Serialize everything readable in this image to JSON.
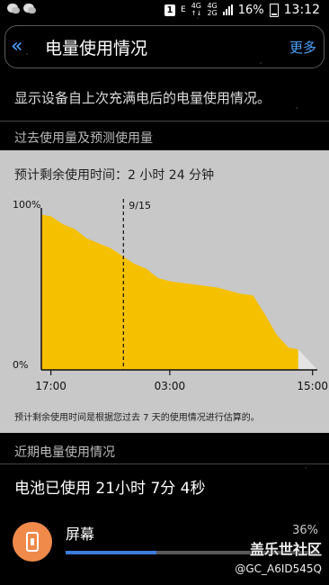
{
  "status_bar": {
    "sim_badge": "1",
    "data_indicator": "E",
    "network_top": "4G",
    "network_bottom": "4G",
    "network_2g": "2G",
    "battery_percent": "16%",
    "time": "13:12"
  },
  "header": {
    "title": "电量使用情况",
    "more_label": "更多"
  },
  "description": "显示设备自上次充满电后的电量使用情况。",
  "section_past": "过去使用量及预测使用量",
  "estimate_text": "预计剩余使用时间：2 小时 24 分钟",
  "chart_data": {
    "type": "area",
    "title": "",
    "ylabel": "",
    "xlabel": "",
    "y_tick_labels": [
      "100%",
      "0%"
    ],
    "x_tick_labels": [
      "17:00",
      "03:00",
      "15:00"
    ],
    "date_marker_label": "9/15",
    "ylim": [
      0,
      100
    ],
    "series": [
      {
        "kind": "used",
        "color": "#f5c000",
        "x": [
          -0.8,
          0,
          1,
          2,
          3,
          4,
          5,
          6,
          7,
          8,
          9,
          10,
          11,
          12,
          13,
          14,
          15,
          16,
          17,
          18,
          19,
          20,
          20.8
        ],
        "y": [
          98,
          97,
          92,
          89,
          83,
          80,
          77,
          72,
          67,
          64,
          58,
          56,
          55,
          54,
          53,
          52,
          50,
          48,
          47,
          35,
          22,
          14,
          13
        ]
      },
      {
        "kind": "predicted",
        "color": "#e4e4e4",
        "x": [
          20.8,
          22.4
        ],
        "y": [
          13,
          0
        ]
      }
    ],
    "x_ticks_hours": [
      0,
      10,
      22
    ],
    "date_marker_hour": 6.1,
    "grid": false
  },
  "footnote": "预计剩余使用时间是根据您过去 7 天的使用情况进行估算的。",
  "section_recent": "近期电量使用情况",
  "battery_used": "电池已使用 21小时 7分 4秒",
  "apps": [
    {
      "name": "屏幕",
      "percent": "36%",
      "fraction": 0.36,
      "icon": "phone-settings-icon"
    }
  ],
  "watermark": {
    "title": "盖乐世社区",
    "user": "@GC_A6ID545Q"
  }
}
